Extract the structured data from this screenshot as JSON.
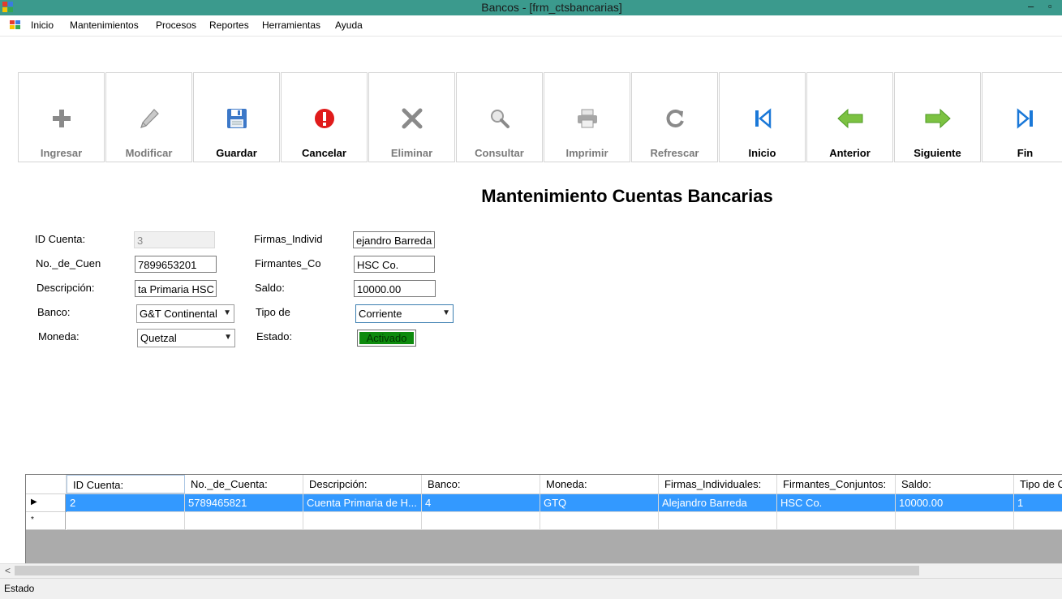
{
  "window": {
    "title": "Bancos - [frm_ctsbancarias]",
    "minimize": "–",
    "restore": "▫"
  },
  "menu": {
    "items": [
      "Inicio",
      "Mantenimientos",
      "Procesos",
      "Reportes",
      "Herramientas",
      "Ayuda"
    ],
    "overflow": "▪"
  },
  "toolbar": {
    "buttons": [
      {
        "label": "Ingresar",
        "icon": "plus-icon",
        "enabled": false
      },
      {
        "label": "Modificar",
        "icon": "pencil-icon",
        "enabled": false
      },
      {
        "label": "Guardar",
        "icon": "floppy-disk-icon",
        "enabled": true
      },
      {
        "label": "Cancelar",
        "icon": "error-icon",
        "enabled": true
      },
      {
        "label": "Eliminar",
        "icon": "x-icon",
        "enabled": false
      },
      {
        "label": "Consultar",
        "icon": "magnifier-icon",
        "enabled": false
      },
      {
        "label": "Imprimir",
        "icon": "printer-icon",
        "enabled": false
      },
      {
        "label": "Refrescar",
        "icon": "refresh-icon",
        "enabled": false
      },
      {
        "label": "Inicio",
        "icon": "first-record-icon",
        "enabled": true
      },
      {
        "label": "Anterior",
        "icon": "arrow-left-icon",
        "enabled": true
      },
      {
        "label": "Siguiente",
        "icon": "arrow-right-icon",
        "enabled": true
      },
      {
        "label": "Fin",
        "icon": "last-record-icon",
        "enabled": true
      }
    ]
  },
  "form": {
    "title": "Mantenimiento Cuentas Bancarias",
    "id_label": "ID Cuenta:",
    "id_value": "3",
    "numero_label": "No._de_Cuen",
    "numero_value": "7899653201",
    "descripcion_label": "Descripción:",
    "descripcion_value": "ta Primaria HSC",
    "banco_label": "Banco:",
    "banco_value": "G&T Continental",
    "moneda_label": "Moneda:",
    "moneda_value": "Quetzal",
    "firmas_label": "Firmas_Individ",
    "firmas_value": "ejandro Barreda",
    "firmantes_label": "Firmantes_Co",
    "firmantes_value": "HSC Co.",
    "saldo_label": "Saldo:",
    "saldo_value": "10000.00",
    "tipo_label": "Tipo de",
    "tipo_value": "Corriente",
    "estado_label": "Estado:",
    "estado_value": "Activado",
    "estado_color": "#0d8a0d"
  },
  "grid": {
    "columns": [
      "ID Cuenta:",
      "No._de_Cuenta:",
      "Descripción:",
      "Banco:",
      "Moneda:",
      "Firmas_Individuales:",
      "Firmantes_Conjuntos:",
      "Saldo:",
      "Tipo de C"
    ],
    "rows": [
      [
        "2",
        "5789465821",
        "Cuenta Primaria de H...",
        "4",
        "GTQ",
        "Alejandro Barreda",
        "HSC Co.",
        "10000.00",
        "1"
      ]
    ],
    "current_marker": "▶",
    "new_marker": "*",
    "selection_color": "#3399ff"
  },
  "scrollbar": {
    "left_arrow": "<"
  },
  "status": {
    "text": "Estado"
  }
}
